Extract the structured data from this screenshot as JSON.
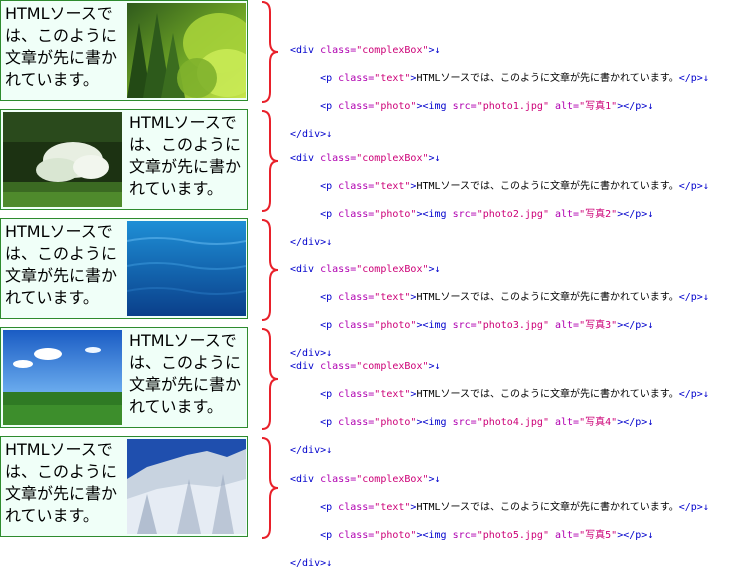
{
  "colors": {
    "box_border": "#2e8b2e",
    "box_bg": "#f0fff8",
    "brace": "#e8202a",
    "tag": "#0000cc",
    "attr": "#b000b0",
    "value": "#cc0077"
  },
  "items": [
    {
      "text": "HTMLソースでは、このように文章が先に書かれています。",
      "photo_src": "photo1.jpg",
      "photo_alt": "写真1",
      "photo_subject": "green-forest",
      "layout": "text-image"
    },
    {
      "text": "HTMLソースでは、このように文章が先に書かれています。",
      "photo_src": "photo2.jpg",
      "photo_alt": "写真2",
      "photo_subject": "white-flowering-shrub",
      "layout": "image-text"
    },
    {
      "text": "HTMLソースでは、このように文章が先に書かれています。",
      "photo_src": "photo3.jpg",
      "photo_alt": "写真3",
      "photo_subject": "blue-water",
      "layout": "text-image"
    },
    {
      "text": "HTMLソースでは、このように文章が先に書かれています。",
      "photo_src": "photo4.jpg",
      "photo_alt": "写真4",
      "photo_subject": "sky-and-grassland",
      "layout": "image-text"
    },
    {
      "text": "HTMLソースでは、このように文章が先に書かれています。",
      "photo_src": "photo5.jpg",
      "photo_alt": "写真5",
      "photo_subject": "snowy-forest",
      "layout": "text-image"
    }
  ],
  "code": {
    "div_open": "<div ",
    "class_attr": "class=",
    "box_class": "\"complexBox\"",
    "close_bracket": ">",
    "p_open": "<p ",
    "text_class": "\"text\"",
    "photo_class": "\"photo\"",
    "img_open": "<img ",
    "src_attr": "src=",
    "alt_attr": "alt=",
    "p_close": "</p>",
    "div_close": "</div>",
    "arrow": "↓",
    "indent": "     "
  }
}
